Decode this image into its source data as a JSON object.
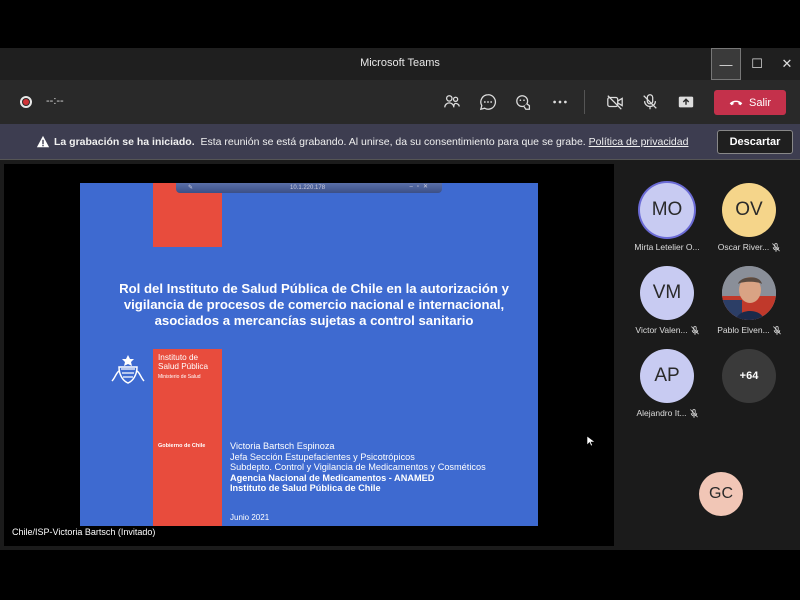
{
  "window": {
    "title": "Microsoft Teams",
    "minimize": "—",
    "maximize": "☐",
    "close": "✕"
  },
  "toolbar": {
    "timer": "--:--",
    "leave_label": "Salir",
    "leave_color": "#c4314b"
  },
  "banner": {
    "bold": "La grabación se ha iniciado.",
    "text": "Esta reunión se está grabando. Al unirse, da su consentimiento para que se grabe.",
    "link": "Política de privacidad",
    "discard_label": "Descartar"
  },
  "slide": {
    "presenter_bar_ip": "10.1.220.178",
    "title": "Rol del Instituto de Salud Pública de Chile en la autorización y vigilancia de procesos de comercio nacional e internacional, asociados a mercancías sujetas a control sanitario",
    "institute_line1": "Instituto de",
    "institute_line2": "Salud Pública",
    "ministry": "Ministerio de Salud",
    "government": "Gobierno de Chile",
    "author_name": "Victoria Bartsch Espinoza",
    "author_role": "Jefa Sección Estupefacientes y Psicotrópicos",
    "author_dept": "Subdepto. Control y Vigilancia de Medicamentos y Cosméticos",
    "agency": "Agencia Nacional de Medicamentos - ANAMED",
    "institute_full": "Instituto de Salud Pública de Chile",
    "date": "Junio 2021",
    "bg_color": "#3e6ad0",
    "accent_color": "#e84c3d"
  },
  "presenter_label": "Chile/ISP-Victoria Bartsch (Invitado)",
  "participants": [
    {
      "initials": "MO",
      "name": "Mirta Letelier O...",
      "color": "#c8cbf2",
      "muted": false
    },
    {
      "initials": "OV",
      "name": "Oscar River...",
      "color": "#f5d58a",
      "muted": true
    },
    {
      "initials": "VM",
      "name": "Victor Valen...",
      "color": "#c8cbf2",
      "muted": true
    },
    {
      "initials": "",
      "name": "Pablo Elven...",
      "color": "#7a7e86",
      "muted": true
    },
    {
      "initials": "AP",
      "name": "Alejandro It...",
      "color": "#c8cbf2",
      "muted": true
    },
    {
      "initials": "GC",
      "name": "",
      "color": "#f1c6b6",
      "muted": false
    }
  ],
  "overflow_count": "+64"
}
